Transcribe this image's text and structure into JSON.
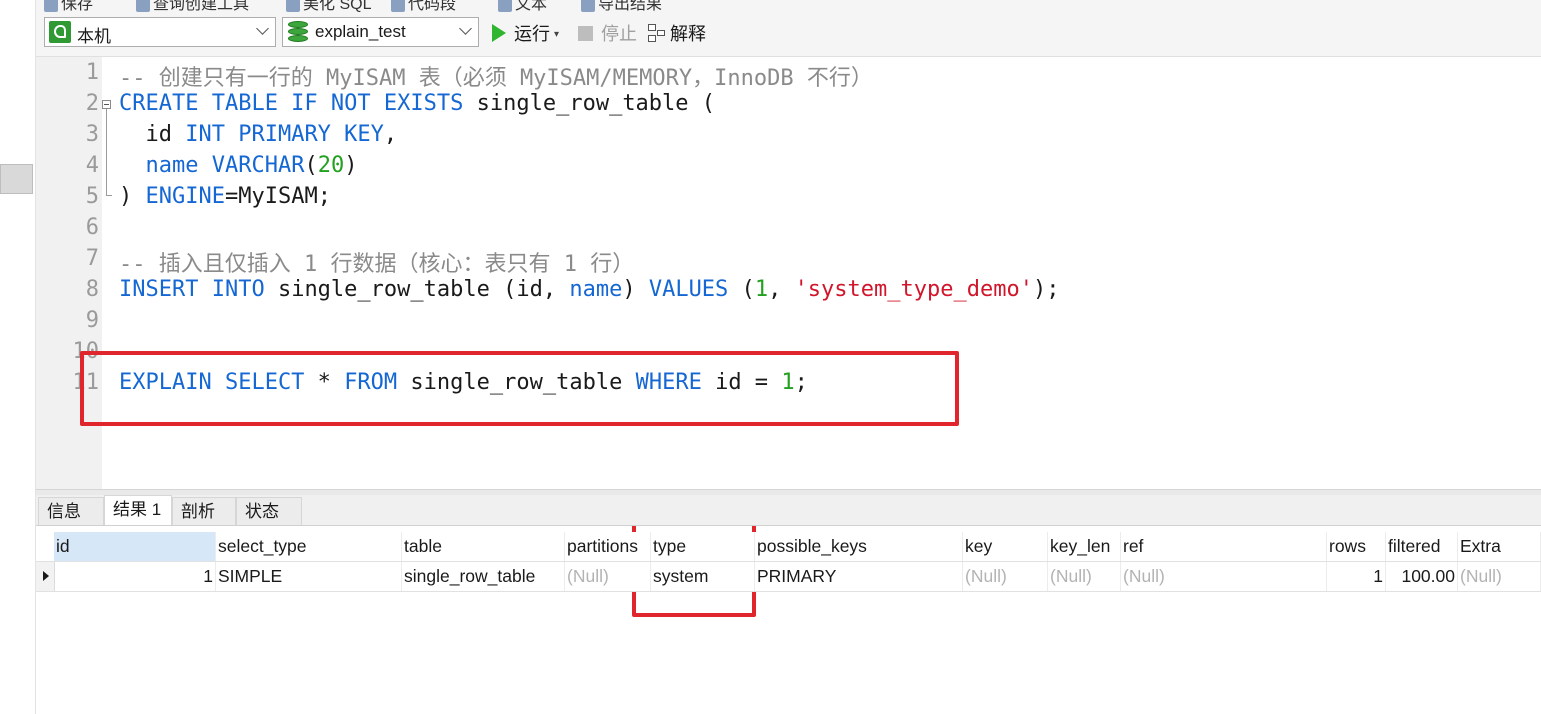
{
  "top_toolbar": {
    "items": [
      "保存",
      "查询创建工具",
      "美化 SQL",
      "代码段",
      "文本",
      "导出结果"
    ]
  },
  "toolbar": {
    "connection": "本机",
    "database": "explain_test",
    "run_label": "运行",
    "stop_label": "停止",
    "explain_label": "解释"
  },
  "editor": {
    "line_numbers": [
      "1",
      "2",
      "3",
      "4",
      "5",
      "6",
      "7",
      "8",
      "9",
      "10",
      "11"
    ],
    "lines": {
      "l1": {
        "comment": "-- 创建只有一行的 MyISAM 表（必须 MyISAM/MEMORY，InnoDB 不行）"
      },
      "l2": {
        "kw1": "CREATE TABLE IF NOT EXISTS",
        "t1": " single_row_table ("
      },
      "l3": {
        "t0": "  id ",
        "kw1": "INT PRIMARY KEY",
        "t1": ","
      },
      "l4": {
        "t0": "  ",
        "kw1": "name VARCHAR",
        "t1": "(",
        "n1": "20",
        "t2": ")"
      },
      "l5": {
        "t0": ") ",
        "kw1": "ENGINE",
        "t1": "=MyISAM;"
      },
      "l7": {
        "comment": "-- 插入且仅插入 1 行数据（核心：表只有 1 行）"
      },
      "l8": {
        "kw1": "INSERT INTO",
        "t1": " single_row_table (id, ",
        "kw2": "name",
        "t2": ") ",
        "kw3": "VALUES",
        "t3": " (",
        "n1": "1",
        "t4": ", ",
        "s1": "'system_type_demo'",
        "t5": ");"
      },
      "l11": {
        "kw1": "EXPLAIN SELECT",
        "t1": " * ",
        "kw2": "FROM",
        "t2": " single_row_table ",
        "kw3": "WHERE",
        "t3": " id = ",
        "n1": "1",
        "t4": ";"
      }
    }
  },
  "result_tabs": [
    "信息",
    "结果 1",
    "剖析",
    "状态"
  ],
  "result_grid": {
    "columns": [
      "id",
      "select_type",
      "table",
      "partitions",
      "type",
      "possible_keys",
      "key",
      "key_len",
      "ref",
      "rows",
      "filtered",
      "Extra"
    ],
    "rows": [
      [
        "1",
        "SIMPLE",
        "single_row_table",
        "(Null)",
        "system",
        "PRIMARY",
        "(Null)",
        "(Null)",
        "(Null)",
        "1",
        "100.00",
        "(Null)"
      ]
    ]
  },
  "colors": {
    "keyword": "#1567d3",
    "comment": "#8a8a8a",
    "number": "#22a020",
    "string": "#d1152a",
    "highlight_box": "#e0262c",
    "null_text": "#b3b3b3"
  },
  "icons": {
    "connection": "mysql-dolphin-icon",
    "database": "database-icon",
    "run": "play-icon",
    "stop": "stop-icon",
    "explain": "explain-icon"
  }
}
